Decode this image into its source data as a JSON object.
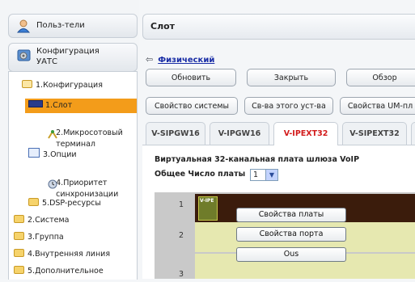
{
  "sidebar": {
    "top_tiles": [
      {
        "label": "Польз-тели",
        "icon": "users-icon"
      },
      {
        "label": "Конфигурация\nУАТС",
        "icon": "config-icon"
      }
    ],
    "items": [
      {
        "label": "1.Конфигурация",
        "icon": "folder-open-icon"
      },
      {
        "label": "1.Слот",
        "icon": "slot-icon",
        "selected": true
      },
      {
        "label": "2.Микросотовый\nтерминал",
        "icon": "antenna-icon"
      },
      {
        "label": "3.Опции",
        "icon": "options-icon"
      },
      {
        "label": "4.Приоритет\nсинхронизации",
        "icon": "sync-icon"
      },
      {
        "label": "5.DSP-ресурсы",
        "icon": "folder-icon"
      },
      {
        "label": "2.Система",
        "icon": "folder-icon"
      },
      {
        "label": "3.Группа",
        "icon": "folder-icon"
      },
      {
        "label": "4.Внутренняя линия",
        "icon": "folder-icon"
      },
      {
        "label": "5.Дополнительное",
        "icon": "folder-icon"
      }
    ]
  },
  "header": {
    "title": "Слот"
  },
  "breadcrumb": {
    "link": "Физический"
  },
  "toolbar": {
    "row1": [
      "Обновить",
      "Закрыть",
      "Обзор"
    ],
    "row2": [
      "Свойство системы",
      "Св-ва этого уст-ва",
      "Свойства UM-пл"
    ]
  },
  "tabs": [
    "V-SIPGW16",
    "V-IPGW16",
    "V-IPEXT32",
    "V-SIPEXT32"
  ],
  "active_tab": "V-IPEXT32",
  "content": {
    "title": "Виртуальная 32-канальная плата шлюза VoIP",
    "count_label": "Общее Число платы",
    "count_value": "1"
  },
  "grid": {
    "rows": [
      "1",
      "2",
      "3"
    ],
    "card_label": "V-IPE"
  },
  "context_menu": [
    "Свойства платы",
    "Свойства порта",
    "Ous"
  ],
  "colors": {
    "accent": "#f39c1a",
    "active_tab_text": "#d21a1a",
    "link": "#1a2ea6",
    "slot_dark": "#3b1c0c",
    "slot_light": "#e6e8b0"
  }
}
